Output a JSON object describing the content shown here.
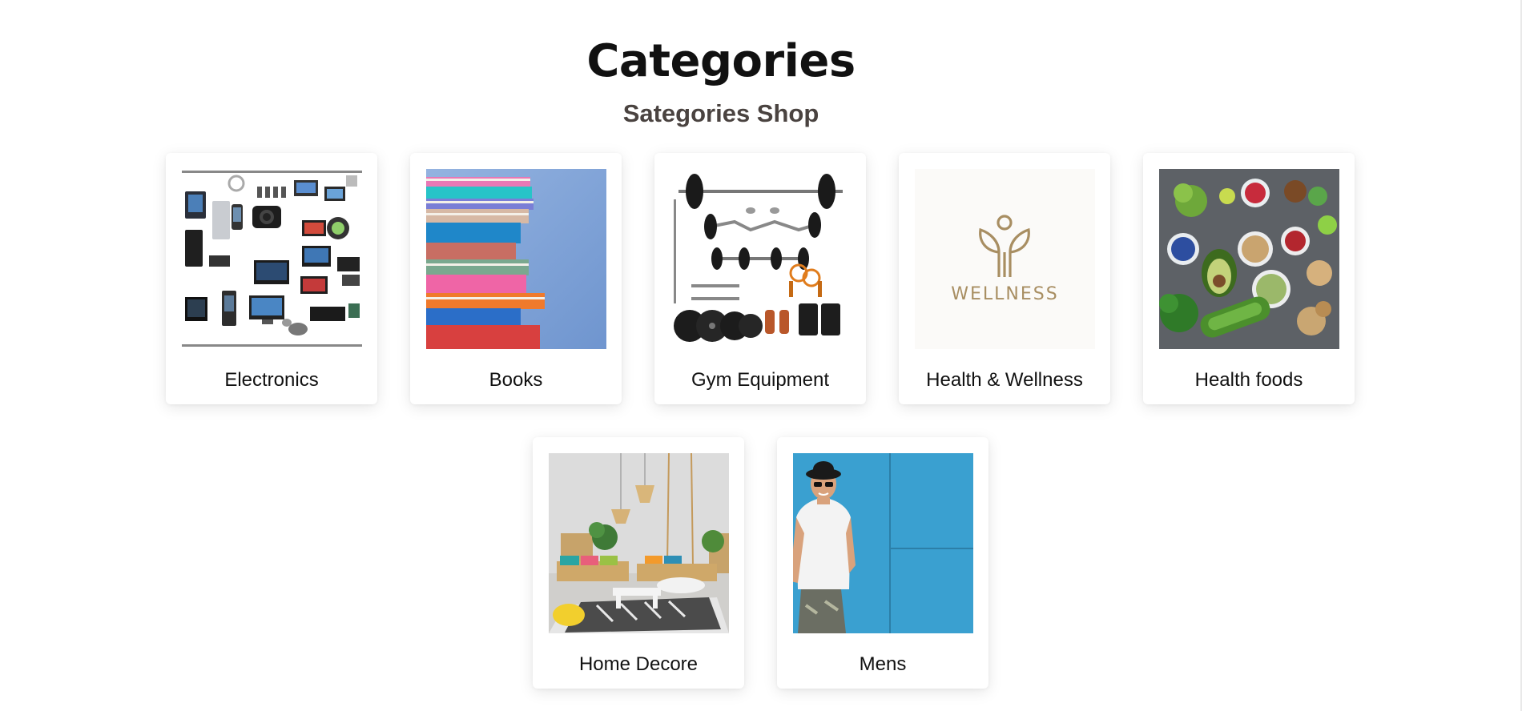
{
  "header": {
    "title": "Categories",
    "subtitle": "Sategories Shop"
  },
  "categories": [
    {
      "label": "Electronics",
      "icon": "electronics-image"
    },
    {
      "label": "Books",
      "icon": "books-image"
    },
    {
      "label": "Gym Equipment",
      "icon": "gym-equipment-image"
    },
    {
      "label": "Health & Wellness",
      "icon": "wellness-logo-image",
      "logo_text": "WELLNESS"
    },
    {
      "label": "Health foods",
      "icon": "health-foods-image"
    },
    {
      "label": "Home Decore",
      "icon": "home-decor-image"
    },
    {
      "label": "Mens",
      "icon": "mens-fashion-image"
    }
  ],
  "colors": {
    "background": "#ffffff",
    "title": "#111111",
    "subtitle": "#4a4340",
    "card": "#ffffff"
  }
}
